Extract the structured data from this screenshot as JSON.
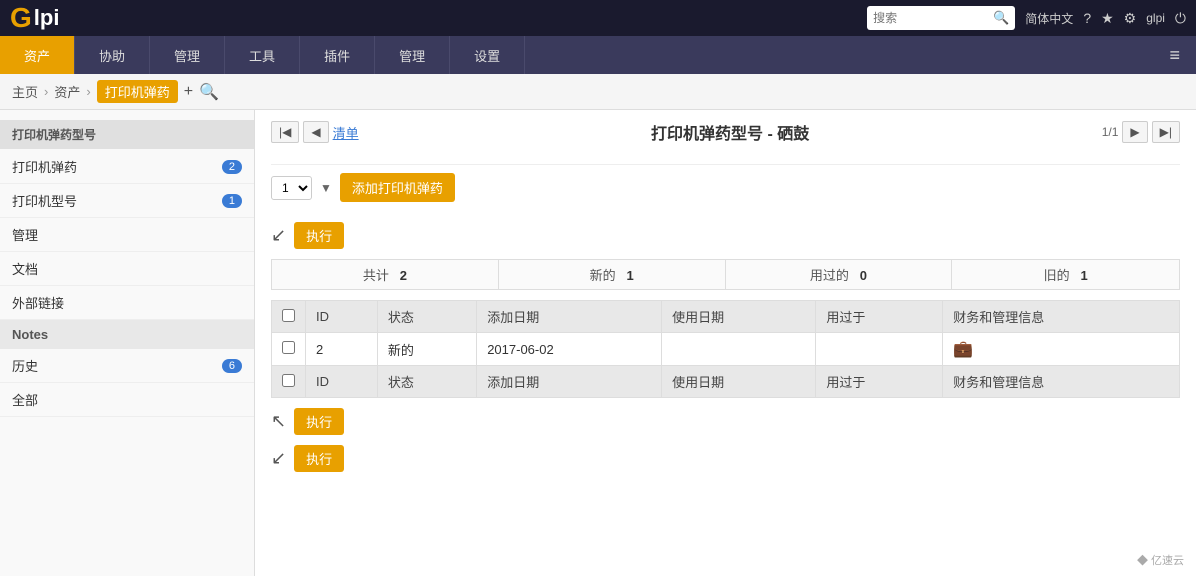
{
  "topbar": {
    "logo_g": "G",
    "logo_lpi": "lpi",
    "search_placeholder": "搜索",
    "lang": "简体中文",
    "user": "glpi"
  },
  "navbar": {
    "items": [
      {
        "label": "资产",
        "active": true
      },
      {
        "label": "协助",
        "active": false
      },
      {
        "label": "管理",
        "active": false
      },
      {
        "label": "工具",
        "active": false
      },
      {
        "label": "插件",
        "active": false
      },
      {
        "label": "管理",
        "active": false
      },
      {
        "label": "设置",
        "active": false
      }
    ]
  },
  "breadcrumb": {
    "home": "主页",
    "asset": "资产",
    "current": "打印机弹药",
    "add_icon": "+",
    "search_icon": "🔍"
  },
  "sidebar": {
    "section_header": "打印机弹药型号",
    "items": [
      {
        "label": "打印机弹药",
        "badge": "2"
      },
      {
        "label": "打印机型号",
        "badge": "1"
      },
      {
        "label": "管理",
        "badge": null
      },
      {
        "label": "文档",
        "badge": null
      },
      {
        "label": "外部链接",
        "badge": null
      },
      {
        "label": "Notes",
        "badge": null,
        "is_notes": true
      },
      {
        "label": "历史",
        "badge": "6"
      },
      {
        "label": "全部",
        "badge": null
      }
    ]
  },
  "content": {
    "list_link": "清单",
    "title": "打印机弹药型号 - 硒鼓",
    "page_info": "1/1",
    "select_default": "1",
    "add_button": "添加打印机弹药",
    "exec_button": "执行",
    "exec_button2": "执行",
    "exec_button3": "执行",
    "stats": [
      {
        "label": "共计",
        "value": "2"
      },
      {
        "label": "新的",
        "value": "1"
      },
      {
        "label": "用过的",
        "value": "0"
      },
      {
        "label": "旧的",
        "value": "1"
      }
    ],
    "table_headers": [
      "ID",
      "状态",
      "添加日期",
      "使用日期",
      "用过于",
      "财务和管理信息"
    ],
    "table_rows": [
      {
        "id": "2",
        "status": "新的",
        "add_date": "2017-06-02",
        "use_date": "",
        "used_by": "",
        "finance": "💼"
      }
    ],
    "table_headers2": [
      "ID",
      "状态",
      "添加日期",
      "使用日期",
      "用过于",
      "财务和管理信息"
    ]
  },
  "watermark": "◆ 亿速云"
}
